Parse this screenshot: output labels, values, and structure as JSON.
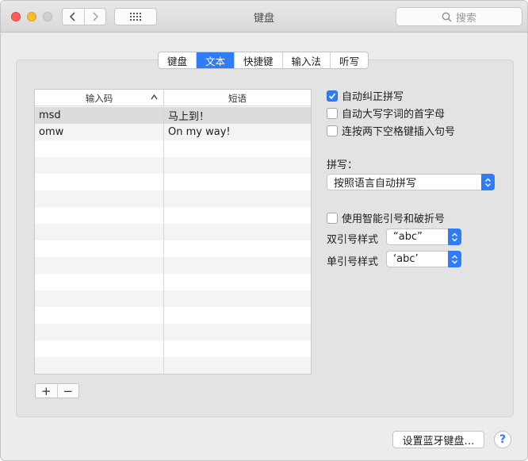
{
  "window": {
    "title": "键盘"
  },
  "search": {
    "placeholder": "搜索",
    "icon": "search-icon"
  },
  "tabs": [
    {
      "label": "键盘",
      "active": false
    },
    {
      "label": "文本",
      "active": true
    },
    {
      "label": "快捷键",
      "active": false
    },
    {
      "label": "输入法",
      "active": false
    },
    {
      "label": "听写",
      "active": false
    }
  ],
  "table": {
    "columns": [
      "输入码",
      "短语"
    ],
    "rows": [
      {
        "replace": "msd",
        "with": "马上到！"
      },
      {
        "replace": "omw",
        "with": "On my way!"
      }
    ],
    "empty_rows": 15
  },
  "options": {
    "autocorrect": {
      "label": "自动纠正拼写",
      "checked": true
    },
    "capitalize": {
      "label": "自动大写字词的首字母",
      "checked": false
    },
    "period": {
      "label": "连按两下空格键插入句号",
      "checked": false
    },
    "spelling_label": "拼写：",
    "spelling_value": "按照语言自动拼写",
    "smart_quotes": {
      "label": "使用智能引号和破折号",
      "checked": false
    },
    "double_label": "双引号样式",
    "double_value": "“abc”",
    "single_label": "单引号样式",
    "single_value": "‘abc’"
  },
  "buttons": {
    "add": "+",
    "remove": "−",
    "bluetooth": "设置蓝牙键盘…",
    "help": "?"
  },
  "colors": {
    "accent": "#2f7cf6"
  }
}
